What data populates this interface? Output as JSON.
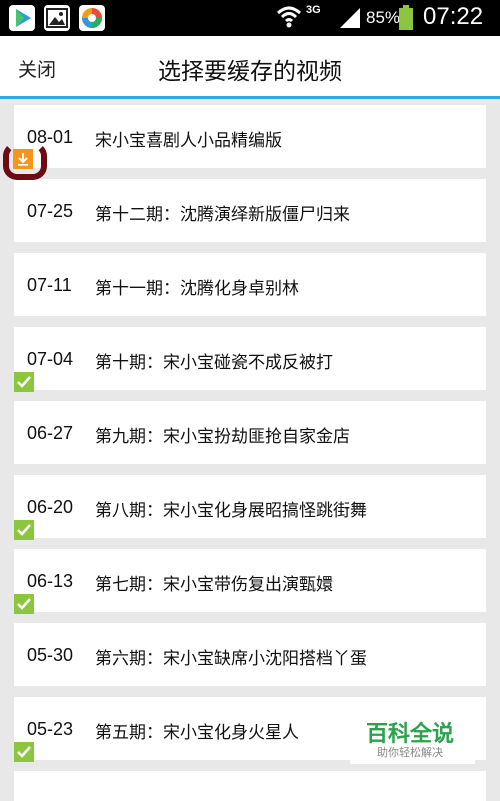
{
  "status_bar": {
    "network_type": "3G",
    "battery_percent": "85%",
    "time": "07:22",
    "icons": [
      "play-store-icon",
      "gallery-icon",
      "color-app-icon",
      "wifi-icon",
      "signal-icon",
      "battery-icon"
    ]
  },
  "header": {
    "close_label": "关闭",
    "title": "选择要缓存的视频"
  },
  "colors": {
    "accent_line": "#29abe2",
    "cached_check": "#8cc63f",
    "downloading_badge": "#f7941d",
    "annotation_circle": "#6b0b16",
    "watermark_green": "#2aa14a"
  },
  "videos": [
    {
      "date": "08-01",
      "title": "宋小宝喜剧人小品精编版",
      "status": "downloading"
    },
    {
      "date": "07-25",
      "title": "第十二期：沈腾演绎新版僵尸归来",
      "status": "none"
    },
    {
      "date": "07-11",
      "title": "第十一期：沈腾化身卓别林",
      "status": "none"
    },
    {
      "date": "07-04",
      "title": "第十期：宋小宝碰瓷不成反被打",
      "status": "cached"
    },
    {
      "date": "06-27",
      "title": "第九期：宋小宝扮劫匪抢自家金店",
      "status": "none"
    },
    {
      "date": "06-20",
      "title": "第八期：宋小宝化身展昭搞怪跳街舞",
      "status": "cached"
    },
    {
      "date": "06-13",
      "title": "第七期：宋小宝带伤复出演甄嬛",
      "status": "cached"
    },
    {
      "date": "05-30",
      "title": "第六期：宋小宝缺席小沈阳搭档丫蛋",
      "status": "none"
    },
    {
      "date": "05-23",
      "title": "第五期：宋小宝化身火星人",
      "status": "cached"
    }
  ],
  "watermark": {
    "title": "百科全说",
    "subtitle": "助你轻松解决"
  }
}
